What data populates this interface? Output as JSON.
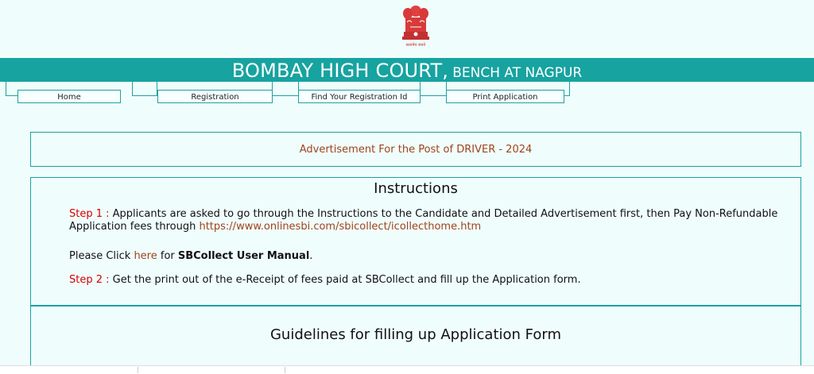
{
  "header": {
    "emblem_caption": "सत्यमेव जयते",
    "title_main": "BOMBAY HIGH COURT,",
    "title_sub": "BENCH AT NAGPUR"
  },
  "nav": {
    "items": [
      {
        "label": "Home"
      },
      {
        "label": "Registration"
      },
      {
        "label": "Find Your Registration Id"
      },
      {
        "label": "Print Application"
      }
    ]
  },
  "advertisement": {
    "title": "Advertisement For the Post of DRIVER - 2024"
  },
  "instructions": {
    "heading": "Instructions",
    "step1_label": "Step 1 :",
    "step1_text": " Applicants are asked to go through the Instructions to the Candidate and Detailed Advertisement first, then Pay Non-Refundable Application fees through ",
    "step1_link": "https://www.onlinesbi.com/sbicollect/icollecthome.htm",
    "manual_prefix": "Please Click ",
    "manual_link": "here",
    "manual_middle": " for ",
    "manual_bold": "SBCollect User Manual",
    "manual_suffix": ".",
    "step2_label": "Step 2 :",
    "step2_text": " Get the print out of the e-Receipt of fees paid at SBCollect and fill up the Application form."
  },
  "guidelines": {
    "heading": "Guidelines for filling up Application Form"
  },
  "colors": {
    "banner": "#17a3a0",
    "background": "#f0fdfd",
    "accent_text": "#a0431a",
    "step_label": "#d60000"
  }
}
